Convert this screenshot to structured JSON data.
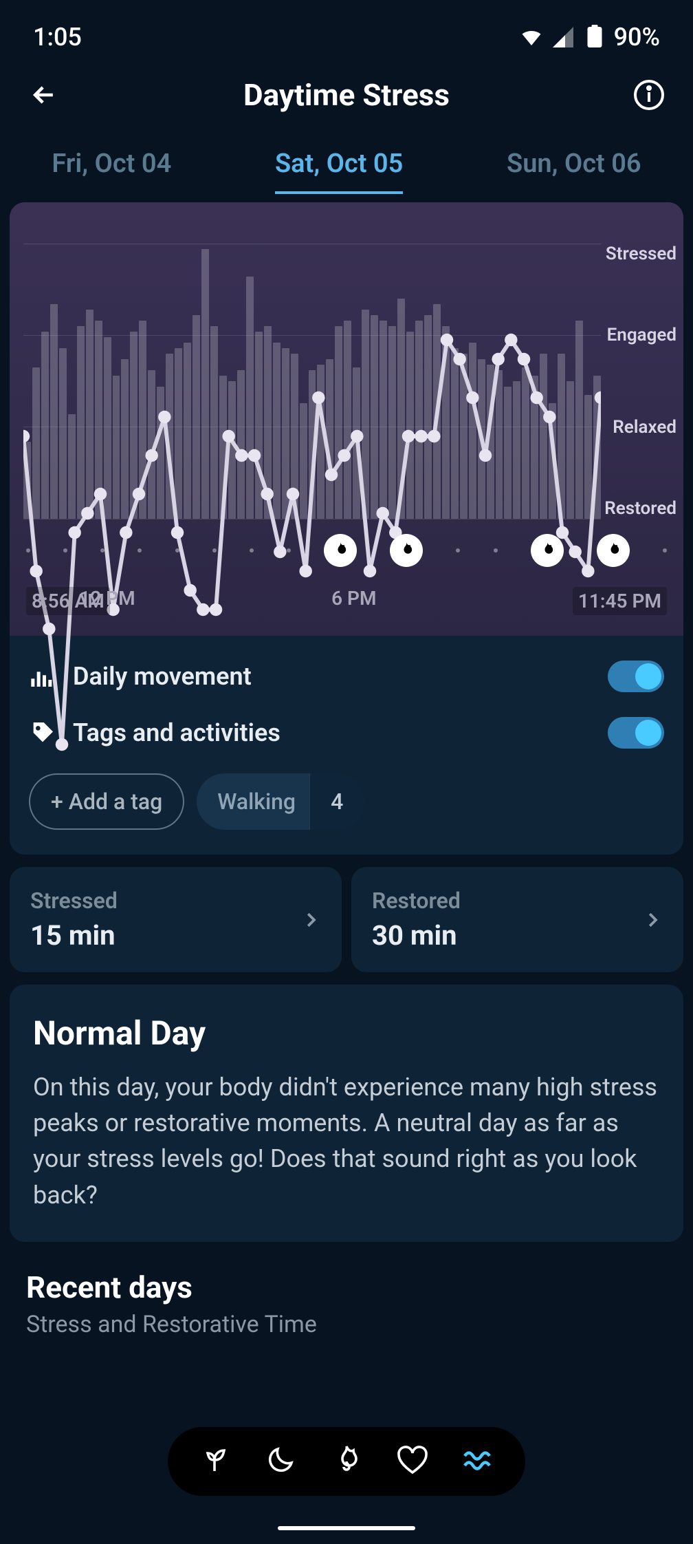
{
  "status": {
    "time": "1:05",
    "battery": "90%"
  },
  "header": {
    "title": "Daytime Stress"
  },
  "tabs": {
    "prev": "Fri, Oct 04",
    "current": "Sat, Oct 05",
    "next": "Sun, Oct 06"
  },
  "chart_data": {
    "type": "line",
    "ylabels": [
      "Stressed",
      "Engaged",
      "Relaxed",
      "Restored"
    ],
    "x_range": [
      "8:56 AM",
      "11:45 PM"
    ],
    "x_ticks": [
      "8:56 AM",
      "12 PM",
      "6 PM",
      "11:45 PM"
    ],
    "ylim": [
      0,
      3
    ],
    "series": [
      {
        "name": "Stress level",
        "values": [
          2.0,
          1.3,
          1.0,
          0.4,
          1.5,
          1.6,
          1.7,
          1.1,
          1.5,
          1.7,
          1.9,
          2.1,
          1.5,
          1.2,
          1.1,
          1.1,
          2.0,
          1.9,
          1.9,
          1.7,
          1.4,
          1.7,
          1.3,
          2.2,
          1.8,
          1.9,
          2.0,
          1.3,
          1.6,
          1.5,
          2.0,
          2.0,
          2.0,
          2.5,
          2.4,
          2.2,
          1.9,
          2.4,
          2.5,
          2.4,
          2.2,
          2.1,
          1.5,
          1.4,
          1.3,
          2.2
        ]
      }
    ],
    "movement_bars": [
      28,
      55,
      68,
      78,
      62,
      38,
      70,
      76,
      72,
      66,
      52,
      58,
      68,
      72,
      54,
      48,
      60,
      62,
      64,
      74,
      98,
      70,
      52,
      50,
      54,
      88,
      68,
      70,
      64,
      62,
      60,
      42,
      54,
      56,
      58,
      70,
      72,
      55,
      76,
      74,
      72,
      70,
      80,
      68,
      72,
      74,
      78,
      70,
      62,
      60,
      64,
      58,
      56,
      54,
      48,
      50,
      55,
      52,
      60,
      42,
      60,
      50,
      72,
      45,
      52
    ],
    "activity_markers": [
      false,
      false,
      false,
      false,
      false,
      false,
      false,
      false,
      true,
      true,
      false,
      false,
      true,
      true,
      false
    ]
  },
  "controls": {
    "movement": "Daily movement",
    "tags": "Tags and activities",
    "add_tag": "+ Add a tag",
    "tag1": {
      "name": "Walking",
      "count": "4"
    }
  },
  "stats": {
    "stressed": {
      "label": "Stressed",
      "value": "15 min"
    },
    "restored": {
      "label": "Restored",
      "value": "30 min"
    }
  },
  "summary": {
    "title": "Normal Day",
    "body": "On this day, your body didn't experience many high stress peaks or restorative moments. A neutral day as far as your stress levels go! Does that sound right as you look back?"
  },
  "recent": {
    "title": "Recent days",
    "subtitle": "Stress and Restorative Time"
  }
}
